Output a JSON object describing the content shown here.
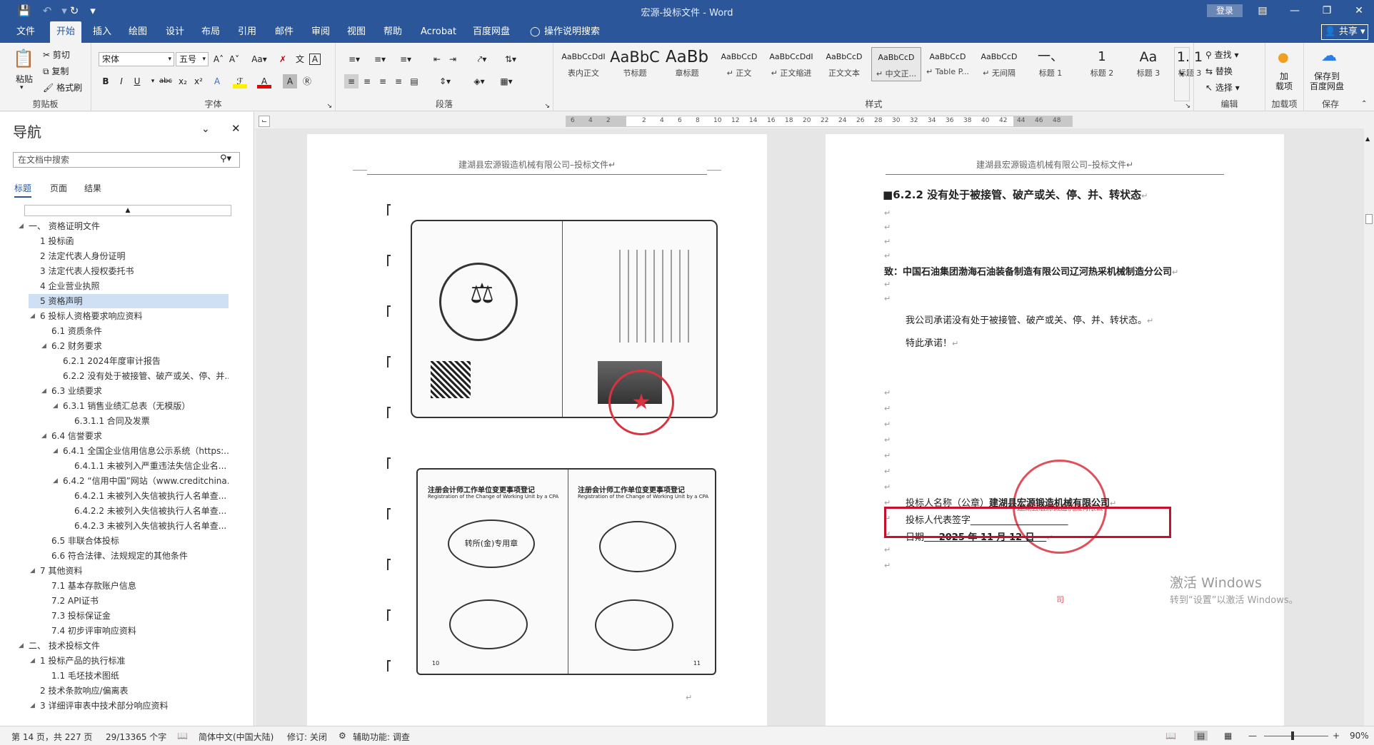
{
  "window": {
    "title": "宏源-投标文件 - Word",
    "login": "登录"
  },
  "tabs": [
    "文件",
    "开始",
    "插入",
    "绘图",
    "设计",
    "布局",
    "引用",
    "邮件",
    "审阅",
    "视图",
    "帮助",
    "Acrobat",
    "百度网盘",
    "操作说明搜索"
  ],
  "share_label": "共享",
  "ribbon": {
    "clipboard": {
      "paste": "粘贴",
      "cut": "剪切",
      "copy": "复制",
      "format_painter": "格式刷",
      "label": "剪贴板"
    },
    "font": {
      "name": "宋体",
      "size": "五号",
      "label": "字体"
    },
    "paragraph": {
      "label": "段落"
    },
    "styles": {
      "label": "样式",
      "items": [
        {
          "preview": "AaBbCcDdI",
          "name": "表内正文"
        },
        {
          "preview": "AaBbC",
          "name": "节标题"
        },
        {
          "preview": "AaBb",
          "name": "章标题"
        },
        {
          "preview": "AaBbCcD",
          "name": "↵ 正文"
        },
        {
          "preview": "AaBbCcDdI",
          "name": "↵ 正文缩进"
        },
        {
          "preview": "AaBbCcD",
          "name": "正文文本"
        },
        {
          "preview": "AaBbCcD",
          "name": "↵ 中文正..."
        },
        {
          "preview": "AaBbCcD",
          "name": "↵ Table P..."
        },
        {
          "preview": "AaBbCcD",
          "name": "↵ 无间隔"
        },
        {
          "preview": "一、",
          "name": "标题 1"
        },
        {
          "preview": "1",
          "name": "标题 2"
        },
        {
          "preview": "Aa",
          "name": "标题 3"
        },
        {
          "preview": "1. 1",
          "name": "标题 3"
        }
      ]
    },
    "editing": {
      "find": "查找",
      "replace": "替换",
      "select": "选择",
      "label": "编辑"
    },
    "addins": {
      "button": "加\n载项",
      "label": "加载项"
    },
    "save": {
      "button": "保存到\n百度网盘",
      "label": "保存"
    }
  },
  "navigation": {
    "title": "导航",
    "search_placeholder": "在文档中搜索",
    "tabs": [
      "标题",
      "页面",
      "结果"
    ],
    "tree": [
      {
        "level": 0,
        "text": "一、 资格证明文件",
        "arrow": true
      },
      {
        "level": 1,
        "text": "1 投标函"
      },
      {
        "level": 1,
        "text": "2 法定代表人身份证明"
      },
      {
        "level": 1,
        "text": "3 法定代表人授权委托书"
      },
      {
        "level": 1,
        "text": "4 企业营业执照"
      },
      {
        "level": 1,
        "text": "5 资格声明",
        "selected": true
      },
      {
        "level": 1,
        "text": "6 投标人资格要求响应资料",
        "arrow": true
      },
      {
        "level": 2,
        "text": "6.1 资质条件"
      },
      {
        "level": 2,
        "text": "6.2 财务要求",
        "arrow": true
      },
      {
        "level": 3,
        "text": "6.2.1 2024年度审计报告"
      },
      {
        "level": 3,
        "text": "6.2.2 没有处于被接管、破产或关、停、并..."
      },
      {
        "level": 2,
        "text": "6.3 业绩要求",
        "arrow": true
      },
      {
        "level": 3,
        "text": "6.3.1 销售业绩汇总表（无模版）",
        "arrow": true
      },
      {
        "level": 4,
        "text": "6.3.1.1 合同及发票"
      },
      {
        "level": 2,
        "text": "6.4 信誉要求",
        "arrow": true
      },
      {
        "level": 3,
        "text": "6.4.1 全国企业信用信息公示系统（https:...",
        "arrow": true
      },
      {
        "level": 4,
        "text": "6.4.1.1 未被列入严重违法失信企业名..."
      },
      {
        "level": 3,
        "text": "6.4.2 “信用中国”网站（www.creditchina....",
        "arrow": true
      },
      {
        "level": 4,
        "text": "6.4.2.1 未被列入失信被执行人名单查..."
      },
      {
        "level": 4,
        "text": "6.4.2.2 未被列入失信被执行人名单查..."
      },
      {
        "level": 4,
        "text": "6.4.2.3 未被列入失信被执行人名单查..."
      },
      {
        "level": 2,
        "text": "6.5 非联合体投标"
      },
      {
        "level": 2,
        "text": "6.6 符合法律、法规规定的其他条件"
      },
      {
        "level": 1,
        "text": "7 其他资料",
        "arrow": true
      },
      {
        "level": 2,
        "text": "7.1 基本存款账户信息"
      },
      {
        "level": 2,
        "text": "7.2 API证书"
      },
      {
        "level": 2,
        "text": "7.3 投标保证金"
      },
      {
        "level": 2,
        "text": "7.4 初步评审响应资料"
      },
      {
        "level": 0,
        "text": "二、 技术投标文件",
        "arrow": true
      },
      {
        "level": 1,
        "text": "1 投标产品的执行标准",
        "arrow": true
      },
      {
        "level": 2,
        "text": "1.1 毛坯技术图纸"
      },
      {
        "level": 1,
        "text": "2 技术条款响应/偏离表"
      },
      {
        "level": 1,
        "text": "3 详细评审表中技术部分响应资料",
        "arrow": true
      }
    ]
  },
  "ruler": [
    "6",
    "4",
    "2",
    "",
    "2",
    "4",
    "6",
    "8",
    "10",
    "12",
    "14",
    "16",
    "18",
    "20",
    "22",
    "24",
    "26",
    "28",
    "30",
    "32",
    "34",
    "36",
    "38",
    "40",
    "42",
    "44",
    "46",
    "48"
  ],
  "left_page": {
    "header": "建湖县宏源锻造机械有限公司–投标文件↵",
    "cert_top_en": "Registration of the Change of Working Unit by a CPA",
    "cert_top_cn": "注册会计师工作单位变更事项登记",
    "stamp_text": "转所(金)专用章",
    "page_numbers": [
      "10",
      "11"
    ]
  },
  "right_page": {
    "header": "建湖县宏源锻造机械有限公司–投标文件↵",
    "heading": "6.2.2 没有处于被接管、破产或关、停、并、转状态",
    "to": "致：中国石油集团渤海石油装备制造有限公司辽河热采机械制造分公司",
    "promise": "我公司承诺没有处于被接管、破产或关、停、并、转状态。",
    "special": "特此承诺！",
    "sig_name_label": "投标人名称（公章）",
    "sig_name_value": "建湖县宏源锻造机械有限公司",
    "sig_rep": "投标人代表签字_____________________",
    "sig_date_label": "日期",
    "sig_date_value": "2025 年 11 月 12 日",
    "stamp_text": "建湖县宏源锻造机械有限公司"
  },
  "activation": {
    "line1": "激活 Windows",
    "line2": "转到“设置”以激活 Windows。"
  },
  "status": {
    "page": "第 14 页，共 227 页",
    "words": "29/13365 个字",
    "lang": "简体中文(中国大陆)",
    "track": "修订: 关闭",
    "access": "辅助功能: 调查",
    "zoom": "90%"
  },
  "colors": {
    "brand": "#2b579a",
    "stamp": "#d9333f",
    "highlight": "#c8102e"
  }
}
